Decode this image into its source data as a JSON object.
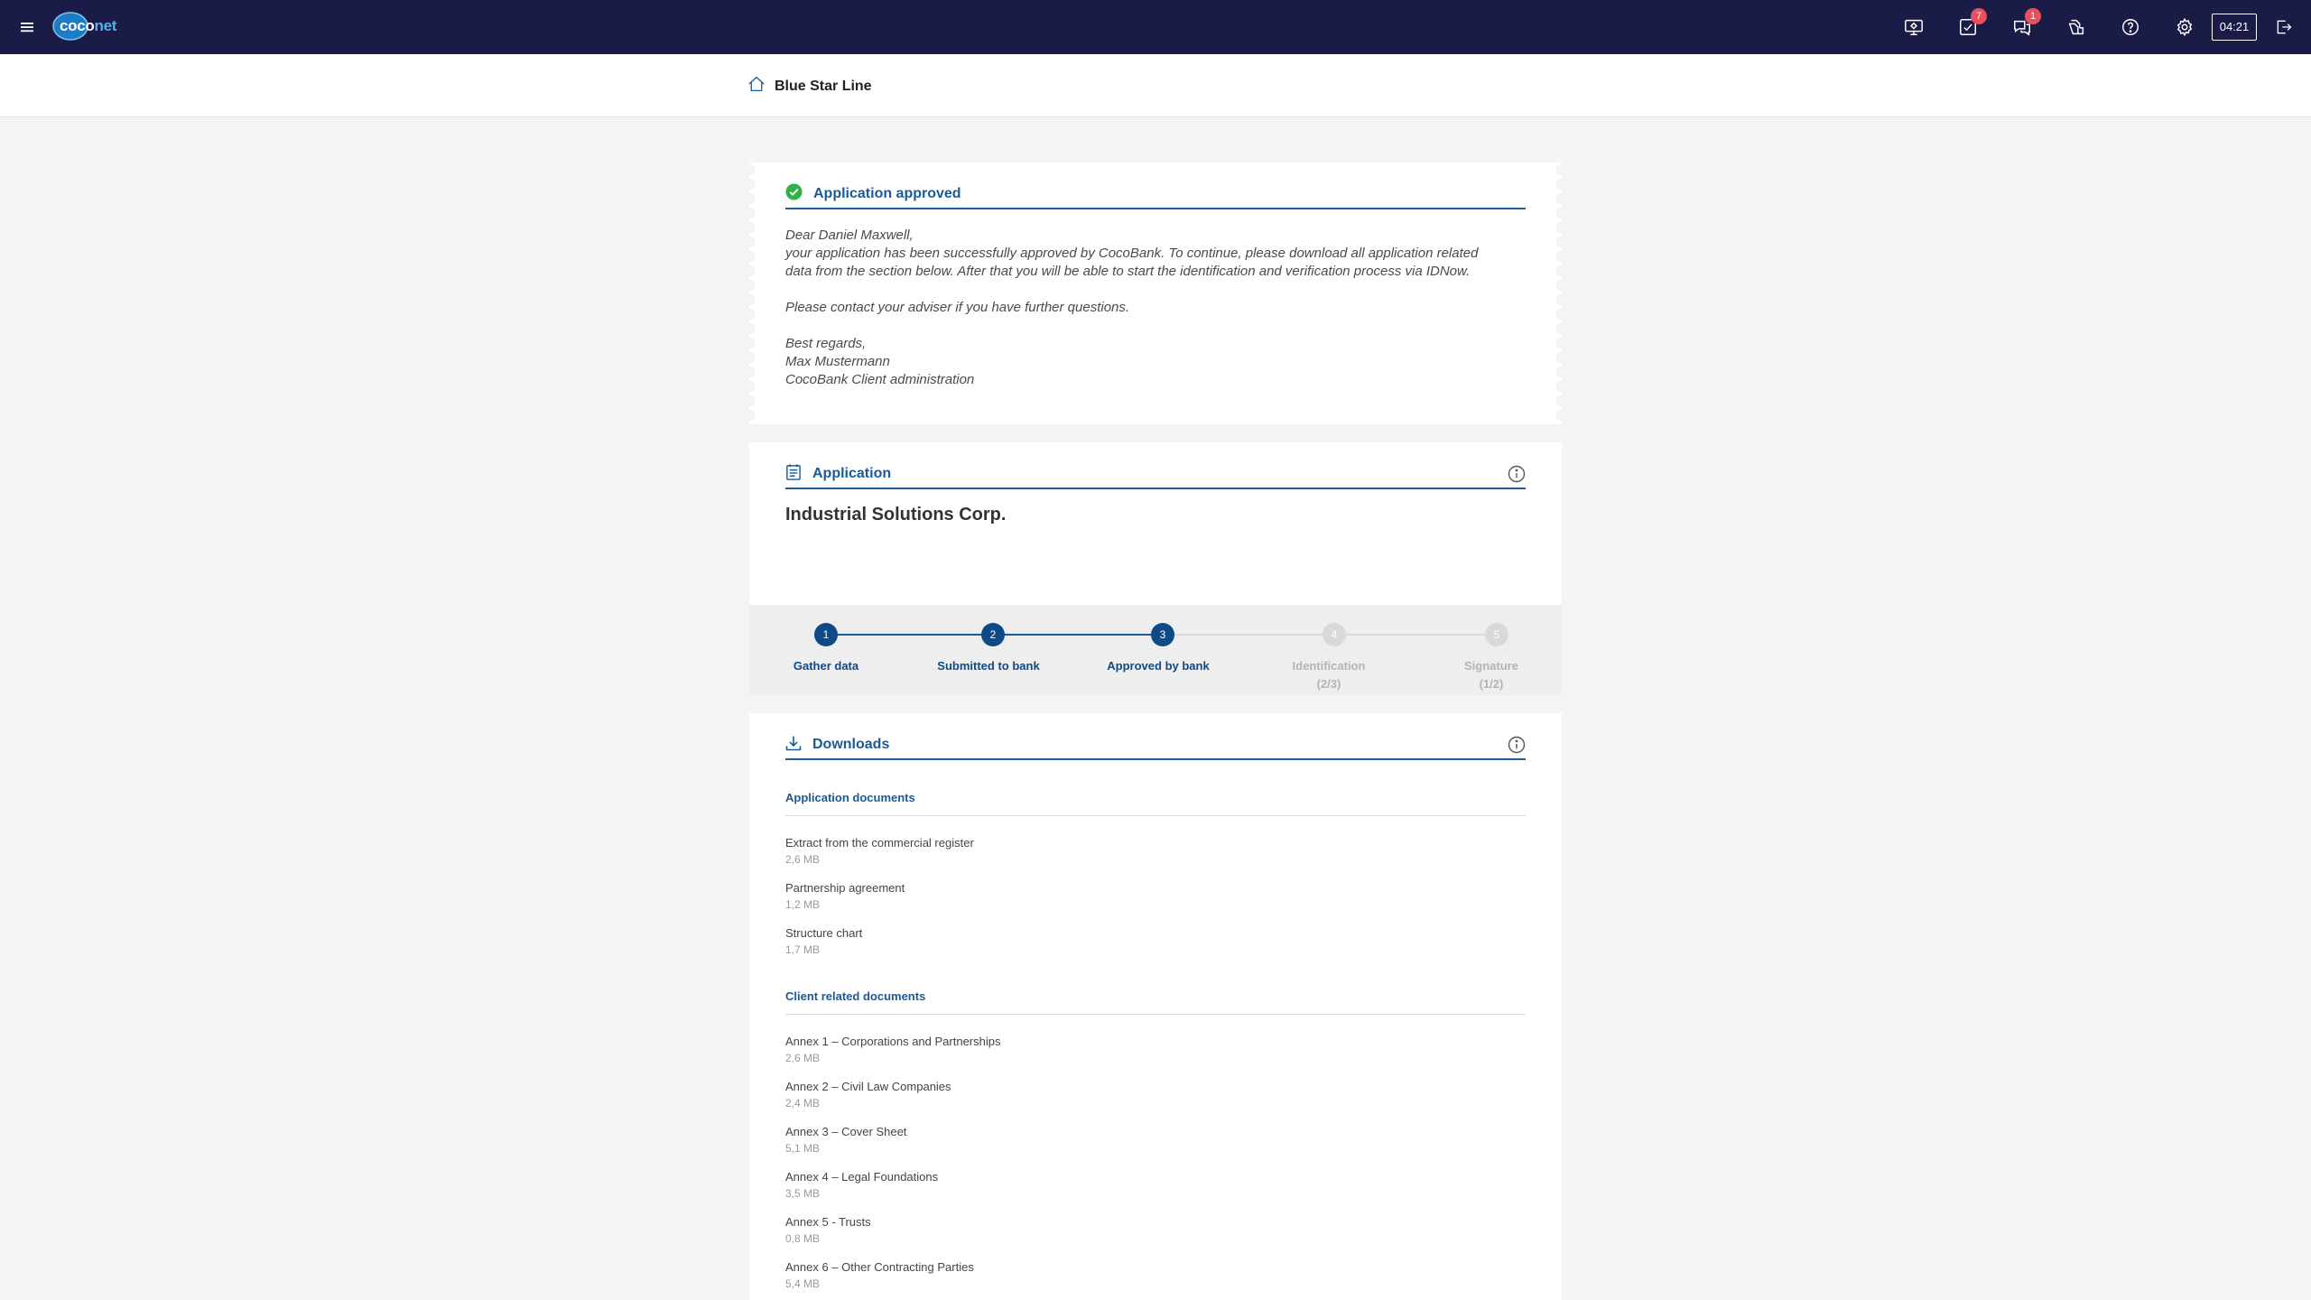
{
  "header": {
    "logo_part1": "coco",
    "logo_part2": "net",
    "icons": [
      {
        "name": "monitor-gear-icon"
      },
      {
        "name": "task-check-icon",
        "badge": "7"
      },
      {
        "name": "chat-icon",
        "badge": "1"
      },
      {
        "name": "handshake-icon"
      },
      {
        "name": "help-icon"
      },
      {
        "name": "settings-icon"
      }
    ],
    "timer": "04:21"
  },
  "breadcrumb": {
    "label": "Blue Star Line"
  },
  "approval": {
    "title": "Application approved",
    "letter": {
      "greeting": "Dear Daniel Maxwell,",
      "line1": "your application has been successfully approved by CocoBank. To continue, please download all application related",
      "line2": "data from the section below. After that you will be able to start the identification and verification process via IDNow.",
      "line3": "Please contact your adviser if you have further questions.",
      "closing": "Best regards,",
      "signer": "Max Mustermann",
      "department": "CocoBank Client administration"
    }
  },
  "application": {
    "title": "Application",
    "company": "Industrial Solutions Corp.",
    "steps": [
      {
        "number": "1",
        "label": "Gather data",
        "sub": "",
        "state": "done"
      },
      {
        "number": "2",
        "label": "Submitted to bank",
        "sub": "",
        "state": "done"
      },
      {
        "number": "3",
        "label": "Approved by bank",
        "sub": "",
        "state": "done"
      },
      {
        "number": "4",
        "label": "Identification",
        "sub": "(2/3)",
        "state": "pending"
      },
      {
        "number": "5",
        "label": "Signature",
        "sub": "(1/2)",
        "state": "pending"
      }
    ]
  },
  "downloads": {
    "title": "Downloads",
    "application_section": {
      "title": "Application documents",
      "items": [
        {
          "name": "Extract from the commercial register",
          "size": "2,6 MB"
        },
        {
          "name": "Partnership agreement",
          "size": "1,2 MB"
        },
        {
          "name": "Structure chart",
          "size": "1,7 MB"
        }
      ]
    },
    "client_section": {
      "title": "Client related documents",
      "items": [
        {
          "name": "Annex 1 – Corporations and Partnerships",
          "size": "2,6 MB"
        },
        {
          "name": "Annex 2 – Civil Law Companies",
          "size": "2,4 MB"
        },
        {
          "name": "Annex 3 – Cover Sheet",
          "size": "5,1 MB"
        },
        {
          "name": "Annex 4 – Legal Foundations",
          "size": "3,5 MB"
        },
        {
          "name": "Annex 5 - Trusts",
          "size": "0,8 MB"
        },
        {
          "name": "Annex 6 – Other Contracting Parties",
          "size": "5,4 MB"
        }
      ]
    }
  },
  "colors": {
    "topbar": "#1b1b48",
    "accent": "#1a5a96",
    "success": "#2db34a",
    "badge": "#e8505b",
    "inactive": "#cfcfcf"
  }
}
